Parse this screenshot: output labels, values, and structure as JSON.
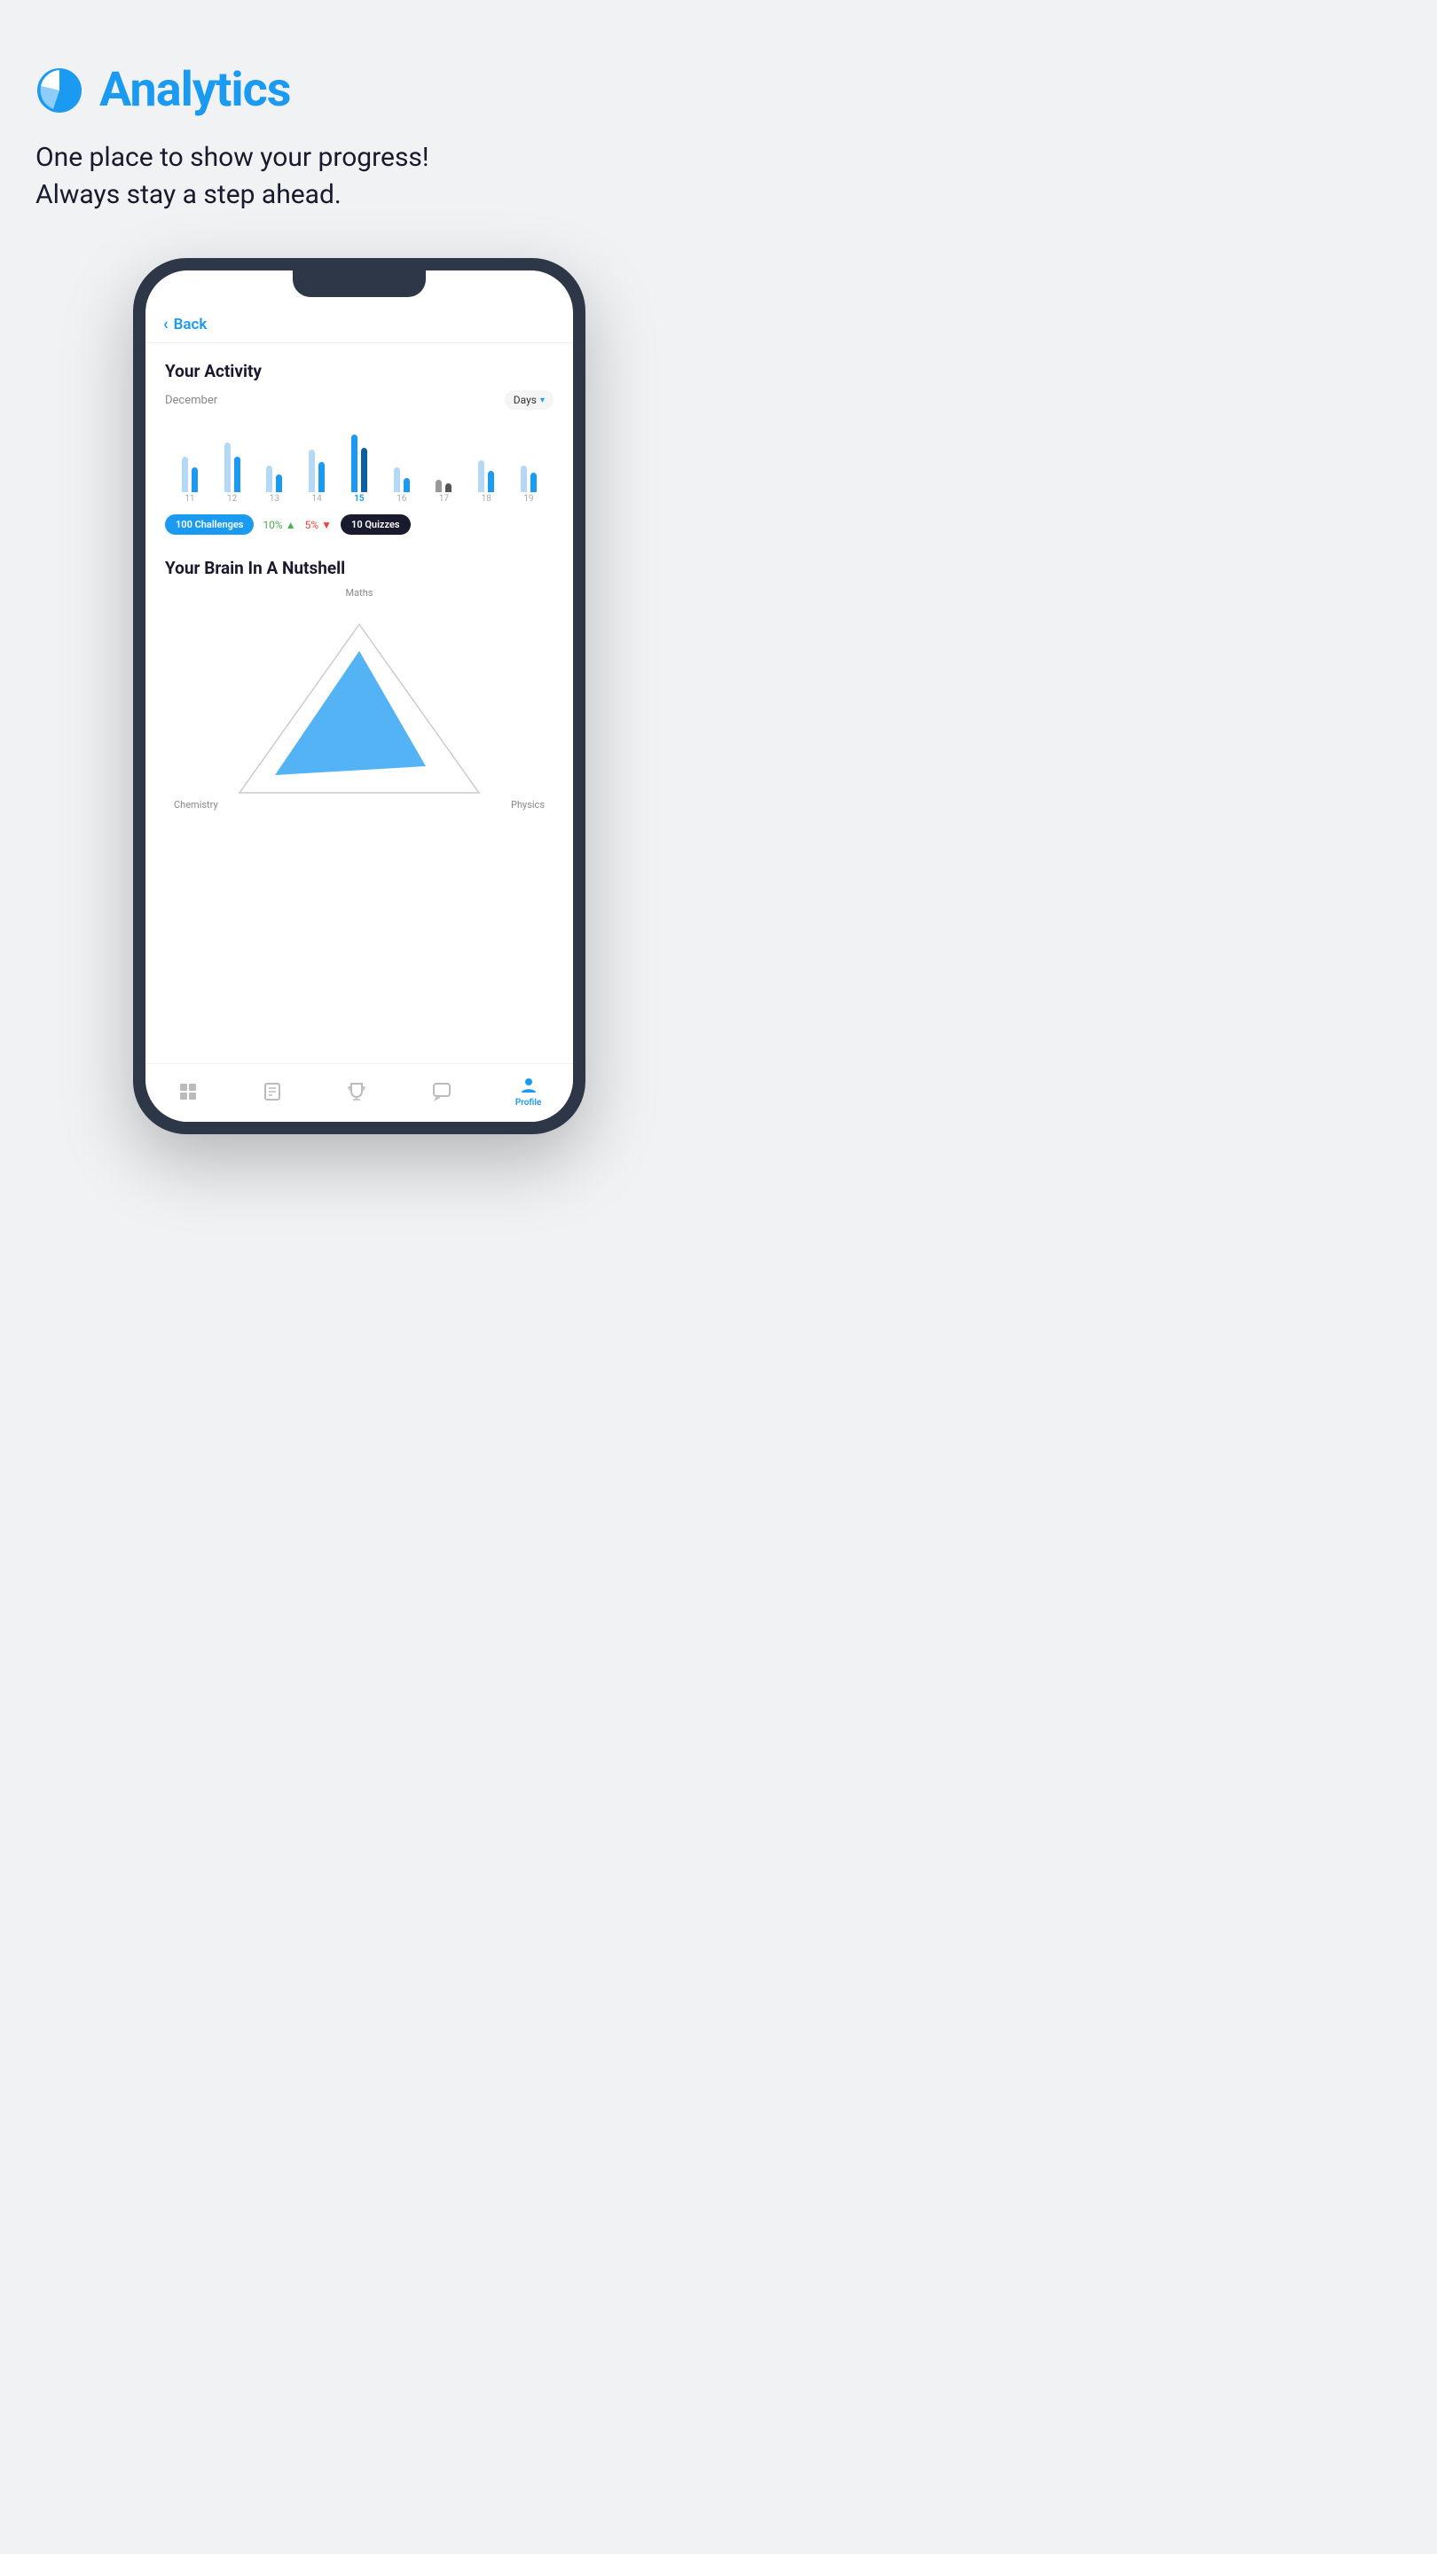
{
  "page": {
    "background": "#f0f2f4"
  },
  "header": {
    "title": "Analytics",
    "subtitle_line1": "One place to show your progress!",
    "subtitle_line2": "Always stay a step ahead."
  },
  "phone": {
    "back_label": "Back",
    "activity_section": {
      "title": "Your Activity",
      "month": "December",
      "filter": "Days",
      "bars": [
        {
          "label": "11",
          "heights": [
            55,
            35
          ],
          "active": false
        },
        {
          "label": "12",
          "heights": [
            70,
            50
          ],
          "active": false
        },
        {
          "label": "13",
          "heights": [
            40,
            25
          ],
          "active": false
        },
        {
          "label": "14",
          "heights": [
            60,
            42
          ],
          "active": false
        },
        {
          "label": "15",
          "heights": [
            75,
            62
          ],
          "active": true
        },
        {
          "label": "16",
          "heights": [
            35,
            20
          ],
          "active": false
        },
        {
          "label": "17",
          "heights": [
            20,
            12
          ],
          "active": false
        },
        {
          "label": "18",
          "heights": [
            45,
            30
          ],
          "active": false
        },
        {
          "label": "19",
          "heights": [
            38,
            28
          ],
          "active": false
        }
      ],
      "stats": {
        "challenges": "100 Challenges",
        "pct_up": "10%",
        "pct_down": "5%",
        "quizzes": "10 Quizzes"
      }
    },
    "brain_section": {
      "title": "Your Brain In A Nutshell",
      "labels": {
        "top": "Maths",
        "bottom_left": "Chemistry",
        "bottom_right": "Physics"
      }
    },
    "bottom_nav": [
      {
        "label": "Home",
        "active": false,
        "icon": "⊞"
      },
      {
        "label": "Learn",
        "active": false,
        "icon": "📖"
      },
      {
        "label": "Trophy",
        "active": false,
        "icon": "🏆"
      },
      {
        "label": "Chat",
        "active": false,
        "icon": "💬"
      },
      {
        "label": "Profile",
        "active": true,
        "icon": "👤"
      }
    ]
  }
}
